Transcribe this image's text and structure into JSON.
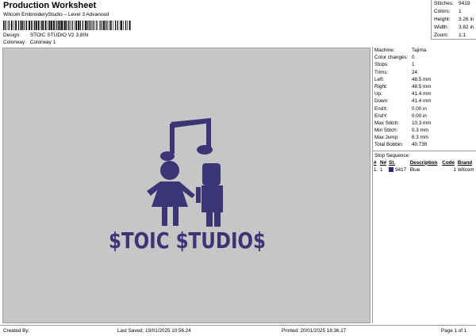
{
  "header": {
    "title": "Production Worksheet",
    "subtitle": "Wilcom EmbroideryStudio – Level 3 Advanced",
    "design_label": "Design:",
    "design_value": "STOIC STUDIO V2 3,8IN",
    "colorway_label": "Colorway:",
    "colorway_value": "Colorway 1"
  },
  "stats": [
    {
      "label": "Stitches:",
      "value": "9419"
    },
    {
      "label": "Colors:",
      "value": "1"
    },
    {
      "label": "Height:",
      "value": "3.26 in"
    },
    {
      "label": "Width:",
      "value": "3.82 in"
    },
    {
      "label": "Zoom:",
      "value": "1:1"
    }
  ],
  "design": {
    "text": "$TOIC $TUDIO$",
    "thread_color": "#3b3575",
    "background": "#c6c6c6"
  },
  "machine": [
    {
      "label": "Machine:",
      "value": "Tajima"
    },
    {
      "label": "Color changes:",
      "value": "0"
    },
    {
      "label": "Stops:",
      "value": "1"
    },
    {
      "label": "Trims:",
      "value": "24"
    },
    {
      "label": "Left:",
      "value": "48.5 mm"
    },
    {
      "label": "Right:",
      "value": "48.5 mm"
    },
    {
      "label": "Up:",
      "value": "41.4 mm"
    },
    {
      "label": "Down:",
      "value": "41.4 mm"
    },
    {
      "label": "EndX:",
      "value": "0.00 in"
    },
    {
      "label": "EndY:",
      "value": "0.00 in"
    },
    {
      "label": "Max Stitch:",
      "value": "10.3 mm"
    },
    {
      "label": "Min Stitch:",
      "value": "0.3 mm"
    },
    {
      "label": "Max Jump:",
      "value": "6.3 mm"
    },
    {
      "label": "Total Bobbin:",
      "value": "40.73ft"
    }
  ],
  "stop_sequence": {
    "title": "Stop Sequence:",
    "headers": [
      "#",
      "N#",
      "St.",
      "Description",
      "Code",
      "Brand"
    ],
    "rows": [
      {
        "num": "1.",
        "n": "1",
        "stitches": "9417",
        "description": "Blue",
        "code": "1",
        "brand": "Wilcom",
        "color": "#2e2a6e"
      }
    ]
  },
  "footer": {
    "created_by": "Created By:",
    "last_saved": "Last Saved: 19/01/2025 10:56.24",
    "printed": "Printed: 20/01/2025 18:36.17",
    "page": "Page 1 of 1"
  }
}
